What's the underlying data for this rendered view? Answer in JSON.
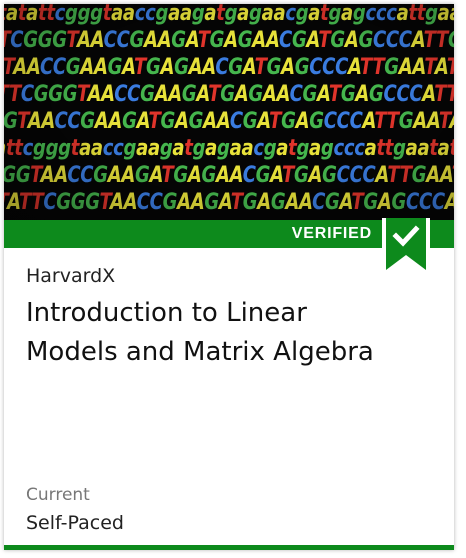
{
  "card": {
    "hero_image": "dna-sequence-image",
    "badge": {
      "label": "VERIFIED",
      "icon": "checkmark-ribbon-icon",
      "color": "#0d8a1c"
    },
    "org": "HarvardX",
    "title": "Introduction to Linear Models and Matrix Algebra",
    "status": "Current",
    "pacing": "Self-Paced"
  }
}
